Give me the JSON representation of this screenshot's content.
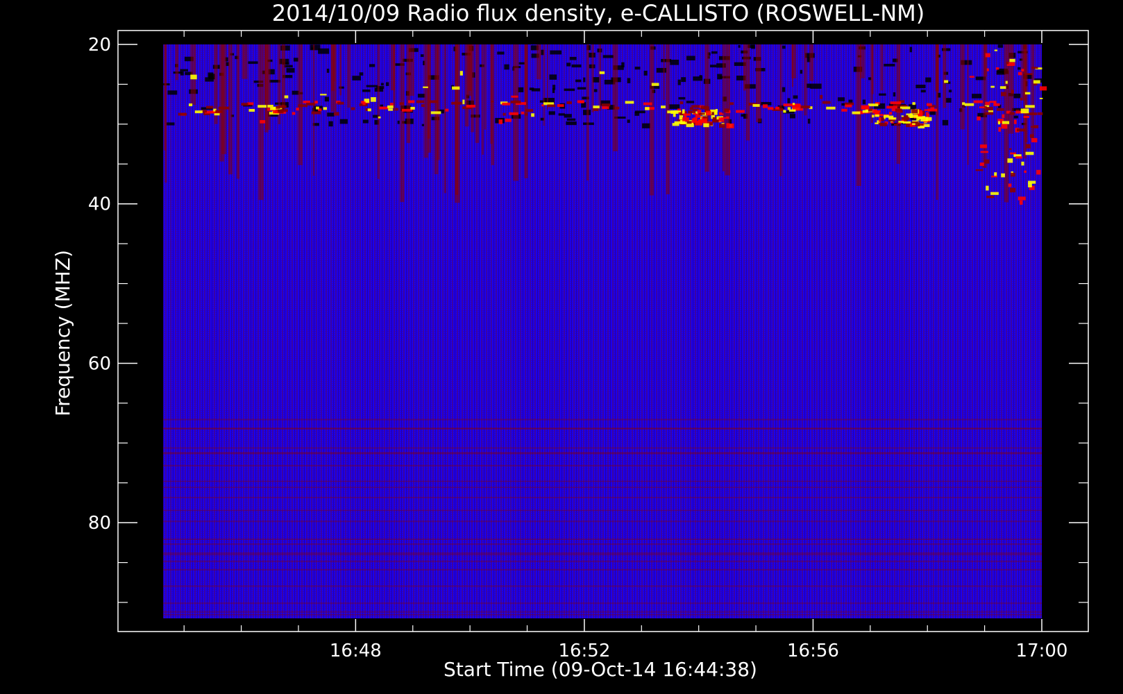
{
  "chart_data": {
    "type": "heatmap",
    "title": "2014/10/09  Radio flux density, e-CALLISTO (ROSWELL-NM)",
    "xlabel": "Start Time (09-Oct-14 16:44:38)",
    "ylabel": "Frequency (MHZ)",
    "x_range": [
      "16:44:38",
      "17:00:00"
    ],
    "y_range_mhz": [
      20,
      92
    ],
    "y_axis_direction": "inverted (low frequency at top)",
    "x_ticks": [
      "16:48",
      "16:52",
      "16:56",
      "17:00"
    ],
    "y_ticks": [
      20,
      40,
      60,
      80
    ],
    "colormap": [
      "#000000",
      "#0000ff",
      "#8b0000",
      "#ff0000",
      "#ffff00",
      "#ffffff"
    ],
    "background_color": "#0000ff",
    "features": [
      {
        "kind": "interference band",
        "freq_mhz": [
          23,
          30
        ],
        "time": [
          "16:44:38",
          "17:00:00"
        ],
        "intensity": "high"
      },
      {
        "kind": "burst",
        "freq_mhz": [
          20,
          40
        ],
        "time": [
          "16:58:50",
          "16:59:55"
        ],
        "intensity": "very high"
      },
      {
        "kind": "bright patch",
        "freq_mhz": [
          28,
          30
        ],
        "time": [
          "16:53:30",
          "16:54:30"
        ],
        "intensity": "very high"
      },
      {
        "kind": "bright patch",
        "freq_mhz": [
          28,
          30
        ],
        "time": [
          "16:57:00",
          "16:58:00"
        ],
        "intensity": "very high"
      }
    ]
  }
}
